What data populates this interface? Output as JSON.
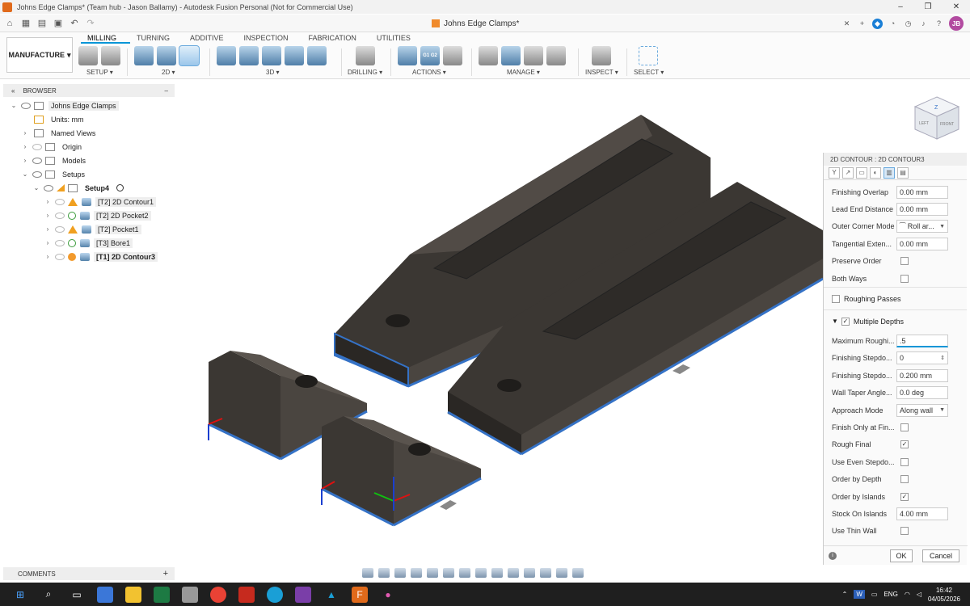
{
  "window": {
    "title": "Johns Edge Clamps* (Team hub - Jason Ballamy) - Autodesk Fusion Personal (Not for Commercial Use)",
    "controls": [
      "–",
      "❐",
      "✕"
    ]
  },
  "doc_tab": {
    "label": "Johns Edge Clamps*",
    "close": "✕"
  },
  "user": {
    "initials": "JB"
  },
  "ribbon": {
    "workspace": "MANUFACTURE",
    "tabs": [
      "MILLING",
      "TURNING",
      "ADDITIVE",
      "INSPECTION",
      "FABRICATION",
      "UTILITIES"
    ],
    "groups": {
      "setup": "SETUP ▾",
      "twod": "2D ▾",
      "threed": "3D ▾",
      "drilling": "DRILLING ▾",
      "actions": "ACTIONS ▾",
      "manage": "MANAGE ▾",
      "inspect": "INSPECT ▾",
      "select": "SELECT ▾"
    },
    "actions_g1g2": "G1 G2"
  },
  "browser": {
    "title": "BROWSER",
    "root": "Johns Edge Clamps",
    "units": "Units: mm",
    "named_views": "Named Views",
    "origin": "Origin",
    "models": "Models",
    "setups": "Setups",
    "setup4": "Setup4",
    "operations": [
      {
        "label": "[T2] 2D Contour1",
        "status": "warning"
      },
      {
        "label": "[T2] 2D Pocket2",
        "status": "ok"
      },
      {
        "label": "[T2] Pocket1",
        "status": "warning"
      },
      {
        "label": "[T3] Bore1",
        "status": "ok"
      },
      {
        "label": "[T1] 2D Contour3",
        "status": "editing"
      }
    ]
  },
  "viewcube": {
    "top": "Z",
    "left": "LEFT",
    "front": "FRONT"
  },
  "panel": {
    "title": "2D CONTOUR : 2D CONTOUR3",
    "rows_top": [
      {
        "label": "Finishing Overlap",
        "value": "0.00 mm",
        "kind": "input"
      },
      {
        "label": "Lead End Distance",
        "value": "0.00 mm",
        "kind": "input"
      },
      {
        "label": "Outer Corner Mode",
        "value": "⁀ Roll ar...",
        "kind": "select"
      },
      {
        "label": "Tangential Exten...",
        "value": "0.00 mm",
        "kind": "input"
      },
      {
        "label": "Preserve Order",
        "value": "",
        "kind": "check"
      },
      {
        "label": "Both Ways",
        "value": "",
        "kind": "check"
      }
    ],
    "roughing_passes": "Roughing Passes",
    "multiple_depths": "Multiple Depths",
    "rows_bottom": [
      {
        "label": "Maximum Roughi...",
        "value": ".5",
        "kind": "focus"
      },
      {
        "label": "Finishing Stepdo...",
        "value": "0",
        "kind": "spin"
      },
      {
        "label": "Finishing Stepdo...",
        "value": "0.200 mm",
        "kind": "input"
      },
      {
        "label": "Wall Taper Angle...",
        "value": "0.0 deg",
        "kind": "input"
      },
      {
        "label": "Approach Mode",
        "value": "Along wall",
        "kind": "select"
      },
      {
        "label": "Finish Only at Fin...",
        "value": "",
        "kind": "check"
      },
      {
        "label": "Rough Final",
        "value": "✓",
        "kind": "check"
      },
      {
        "label": "Use Even Stepdo...",
        "value": "",
        "kind": "check"
      },
      {
        "label": "Order by Depth",
        "value": "",
        "kind": "check"
      },
      {
        "label": "Order by Islands",
        "value": "✓",
        "kind": "check"
      },
      {
        "label": "Stock On Islands",
        "value": "4.00 mm",
        "kind": "input"
      },
      {
        "label": "Use Thin Wall",
        "value": "",
        "kind": "check"
      }
    ],
    "ok": "OK",
    "cancel": "Cancel"
  },
  "comments": {
    "label": "COMMENTS",
    "add": "+"
  },
  "taskbar": {
    "lang": "ENG",
    "time": "16:42",
    "date": "04/05/2026"
  }
}
